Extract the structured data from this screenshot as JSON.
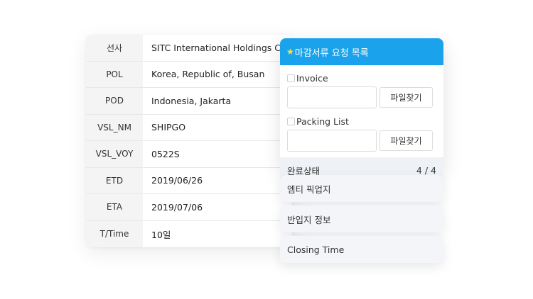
{
  "shipment_info": {
    "rows": [
      {
        "label": "선사",
        "value": "SITC International Holdings Co."
      },
      {
        "label": "POL",
        "value": "Korea, Republic of, Busan"
      },
      {
        "label": "POD",
        "value": "Indonesia, Jakarta"
      },
      {
        "label": "VSL_NM",
        "value": "SHIPGO"
      },
      {
        "label": "VSL_VOY",
        "value": "0522S"
      },
      {
        "label": "ETD",
        "value": "2019/06/26"
      },
      {
        "label": "ETA",
        "value": "2019/07/06"
      },
      {
        "label": "T/Time",
        "value": "10일"
      }
    ]
  },
  "closing_request": {
    "title_icon": "★",
    "title": "마감서류 요청 목록",
    "documents": [
      {
        "label": "Invoice",
        "button": "파일찾기"
      },
      {
        "label": "Packing List",
        "button": "파일찾기"
      }
    ],
    "status_label": "완료상태",
    "status_value": "4 / 4"
  },
  "cards": [
    {
      "label": "엠티 픽업지"
    },
    {
      "label": "반입지 정보"
    },
    {
      "label": "Closing Time"
    }
  ],
  "colors": {
    "header_bg": "#1aa3ec",
    "star": "#ffe23a",
    "label_bg": "#f4f4f4",
    "card_bg": "#f3f5f9"
  }
}
